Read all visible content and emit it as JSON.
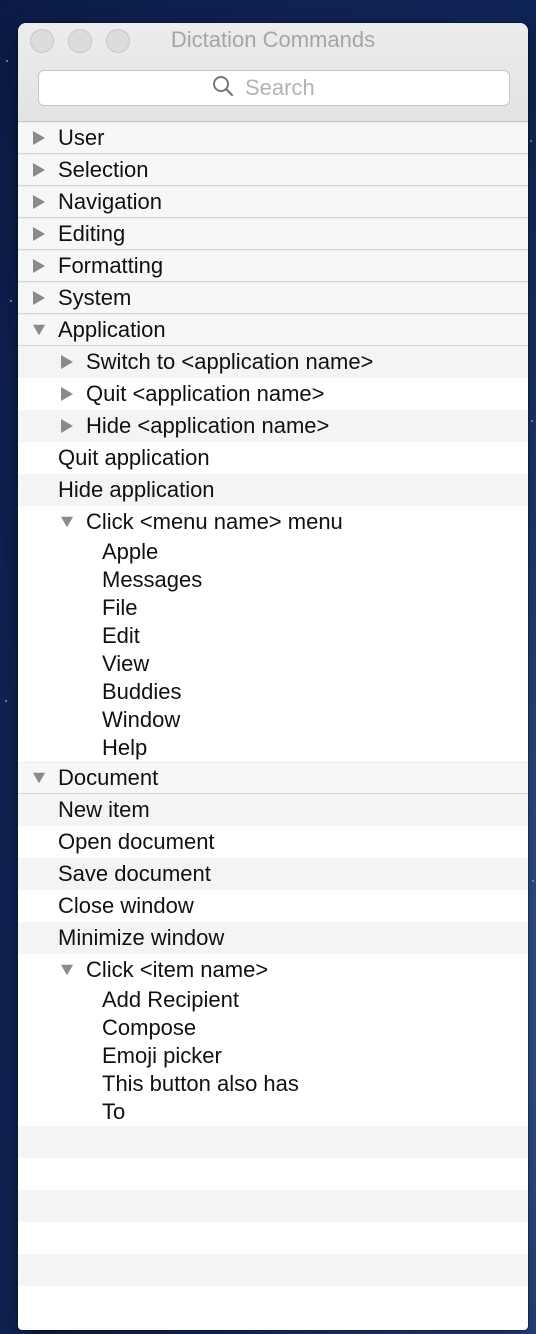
{
  "window": {
    "title": "Dictation Commands"
  },
  "search": {
    "placeholder": "Search"
  },
  "groups": {
    "user": "User",
    "selection": "Selection",
    "navigation": "Navigation",
    "editing": "Editing",
    "formatting": "Formatting",
    "system": "System",
    "application": "Application",
    "document": "Document"
  },
  "application": {
    "switch_to": "Switch to <application name>",
    "quit_named": "Quit <application name>",
    "hide_named": "Hide <application name>",
    "quit": "Quit application",
    "hide": "Hide application",
    "click_menu": "Click <menu name> menu",
    "menus": [
      "Apple",
      "Messages",
      "File",
      "Edit",
      "View",
      "Buddies",
      "Window",
      "Help"
    ]
  },
  "document": {
    "new_item": "New item",
    "open": "Open document",
    "save": "Save document",
    "close": "Close window",
    "minimize": "Minimize window",
    "click_item": "Click <item name>",
    "items": [
      "Add Recipient",
      "Compose",
      "Emoji picker",
      "This button also has",
      "To"
    ]
  },
  "icons": {
    "collapsed": "disclosure-triangle-right",
    "expanded": "disclosure-triangle-down",
    "search": "magnifying-glass"
  }
}
